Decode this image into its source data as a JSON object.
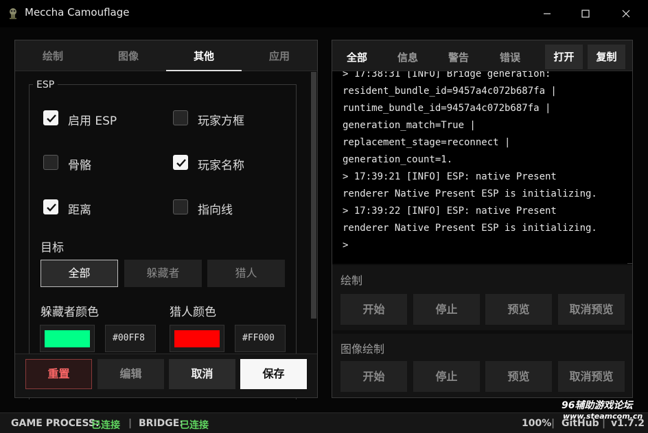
{
  "window": {
    "title": "Meccha Camouflage",
    "minimize_icon": "minimize-icon",
    "maximize_icon": "maximize-icon",
    "close_icon": "close-icon"
  },
  "left_panel": {
    "tabs": [
      "绘制",
      "图像",
      "其他",
      "应用"
    ],
    "active_tab": "其他",
    "esp": {
      "title": "ESP",
      "options": [
        {
          "label": "启用 ESP",
          "checked": true
        },
        {
          "label": "玩家方框",
          "checked": false
        },
        {
          "label": "骨骼",
          "checked": false
        },
        {
          "label": "玩家名称",
          "checked": true
        },
        {
          "label": "距离",
          "checked": true
        },
        {
          "label": "指向线",
          "checked": false
        }
      ],
      "target_label": "目标",
      "targets": [
        "全部",
        "躲藏者",
        "猎人"
      ],
      "active_target": "全部",
      "hider_color_label": "躲藏者颜色",
      "hider_color": "#00FF88",
      "hider_color_text": "#00FF8",
      "hunter_color_label": "猎人颜色",
      "hunter_color": "#FF0000",
      "hunter_color_text": "#FF000"
    },
    "footer": {
      "reset": "重置",
      "edit": "编辑",
      "cancel": "取消",
      "save": "保存"
    }
  },
  "right_panel": {
    "tabs": [
      "全部",
      "信息",
      "警告",
      "错误"
    ],
    "active_tab": "全部",
    "open_button": "打开",
    "copy_button": "复制",
    "log_lines": [
      "> 17:38:31 [INFO] Bridge generation:",
      "resident_bundle_id=9457a4c072b687fa |",
      "runtime_bundle_id=9457a4c072b687fa |",
      "generation_match=True |",
      "replacement_stage=reconnect |",
      "generation_count=1.",
      "> 17:39:21 [INFO] ESP: native Present",
      "renderer Native Present ESP is initializing.",
      "> 17:39:22 [INFO] ESP: native Present",
      "renderer Native Present ESP is initializing.",
      ">"
    ],
    "draw_section": {
      "title": "绘制",
      "buttons": [
        "开始",
        "停止",
        "预览",
        "取消预览"
      ]
    },
    "image_section": {
      "title": "图像绘制",
      "buttons": [
        "开始",
        "停止",
        "预览",
        "取消预览"
      ]
    }
  },
  "status_bar": {
    "game_process_label": "GAME PROCESS:",
    "game_process_value": "已连接",
    "separator": "|",
    "bridge_label": "BRIDGE:",
    "bridge_value": "已连接",
    "zoom": "100%",
    "github": "GitHub",
    "version": "v1.7.2",
    "connected_color": "#5fd35f"
  },
  "watermark": {
    "line1": "96辅助游戏论坛",
    "line2": "www.steamcom.cn"
  }
}
